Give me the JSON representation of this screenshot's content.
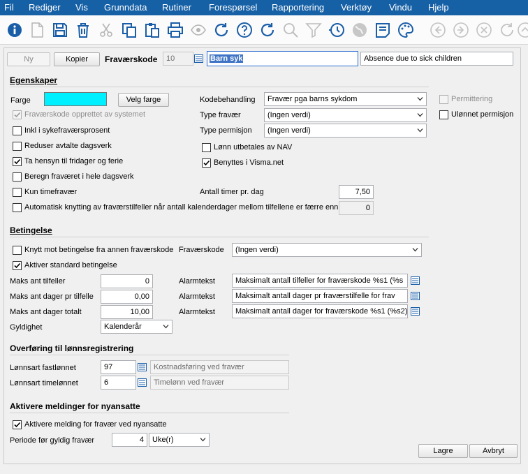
{
  "menu": [
    "Fil",
    "Rediger",
    "Vis",
    "Grunndata",
    "Rutiner",
    "Forespørsel",
    "Rapportering",
    "Verktøy",
    "Vindu",
    "Hjelp"
  ],
  "colors": {
    "menubar": "#1660a6",
    "accent_icon": "#1a5ea8",
    "farge_swatch": "#00f0ff",
    "selected_text_bg": "#3f73c6"
  },
  "toolbar": {
    "icons": [
      "info-icon",
      "new-document-icon",
      "save-icon",
      "delete-icon",
      "cut-icon",
      "copy-icon",
      "paste-icon",
      "print-icon",
      "preview-icon",
      "refresh-icon",
      "help-icon",
      "refresh-alt-icon",
      "search-icon",
      "filter-icon",
      "history-icon",
      "globe-icon",
      "notes-icon",
      "palette-icon",
      "back-icon",
      "forward-icon",
      "close-icon",
      "undo-icon",
      "up-icon"
    ]
  },
  "header": {
    "ny": "Ny",
    "kopier": "Kopier",
    "fravaerskode_label": "Fraværskode",
    "code": "10",
    "name": "Barn syk",
    "description": "Absence due to sick children"
  },
  "egenskaper": {
    "title": "Egenskaper",
    "farge_label": "Farge",
    "velg_farge": "Velg farge",
    "chk_opprettet": "Fraværskode opprettet av systemet",
    "chk_inkl": "Inkl i sykefraværsprosent",
    "chk_reduser": "Reduser avtalte dagsverk",
    "chk_hensyn": "Ta hensyn til fridager og ferie",
    "chk_beregn": "Beregn fraværet i hele dagsverk",
    "chk_kun": "Kun timefravær",
    "chk_auto": "Automatisk knytting av fraværstilfeller når antall kalenderdager mellom tilfellene er færre enn",
    "auto_value": "0",
    "kodebehandling_label": "Kodebehandling",
    "kodebehandling_value": "Fravær pga barns sykdom",
    "type_fravaer_label": "Type fravær",
    "type_fravaer_value": "(Ingen verdi)",
    "type_permisjon_label": "Type permisjon",
    "type_permisjon_value": "(Ingen verdi)",
    "chk_lonn_nav": "Lønn utbetales av NAV",
    "chk_visma": "Benyttes i Visma.net",
    "antall_timer_label": "Antall timer pr. dag",
    "antall_timer_value": "7,50",
    "chk_permittering": "Permittering",
    "chk_ulonnet": "Ulønnet permisjon"
  },
  "betingelse": {
    "title": "Betingelse",
    "chk_knytt": "Knytt mot betingelse fra annen fraværskode",
    "fravaerskode_label": "Fraværskode",
    "fravaerskode_value": "(Ingen verdi)",
    "chk_aktiver": "Aktiver standard betingelse",
    "maks_tilfeller_label": "Maks ant tilfeller",
    "maks_tilfeller_value": "0",
    "maks_dager_tilfelle_label": "Maks ant dager pr tilfelle",
    "maks_dager_tilfelle_value": "0,00",
    "maks_dager_totalt_label": "Maks ant dager totalt",
    "maks_dager_totalt_value": "10,00",
    "gyldighet_label": "Gyldighet",
    "gyldighet_value": "Kalenderår",
    "alarmtekst_label": "Alarmtekst",
    "alarm1": "Maksimalt antall tilfeller for fraværskode %s1 (%s",
    "alarm2": "Maksimalt antall dager pr fraværstilfelle for frav",
    "alarm3": "Maksimalt antall dager for fraværskode %s1 (%s2)"
  },
  "overforing": {
    "title": "Overføring til lønnsregistrering",
    "fastlonnet_label": "Lønnsart fastlønnet",
    "fastlonnet_value": "97",
    "fastlonnet_desc": "Kostnadsføring ved fravær",
    "timelonnet_label": "Lønnsart timelønnet",
    "timelonnet_value": "6",
    "timelonnet_desc": "Timelønn ved fravær"
  },
  "meldinger": {
    "title": "Aktivere meldinger for nyansatte",
    "chk_aktivere": "Aktivere melding for fravær ved nyansatte",
    "periode_label": "Periode før gyldig fravær",
    "periode_value": "4",
    "periode_unit": "Uke(r)"
  },
  "footer": {
    "lagre": "Lagre",
    "avbryt": "Avbryt"
  }
}
